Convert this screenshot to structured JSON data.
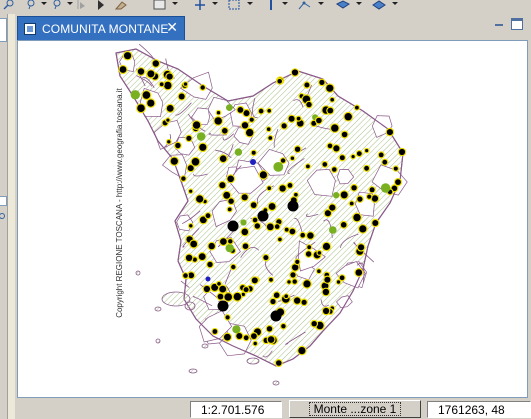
{
  "toolbar": {
    "buttons": [
      {
        "icon": "zoom-in-icon"
      },
      {
        "icon": "zoom-out-icon"
      },
      {
        "icon": "zoom-box-icon"
      },
      {
        "icon": "select-pointer-icon"
      },
      {
        "icon": "eraser-icon"
      },
      {
        "icon": "pan-icon"
      },
      {
        "icon": "select-rect-icon"
      },
      {
        "icon": "info-icon"
      },
      {
        "icon": "measure-icon"
      },
      {
        "icon": "layer-icon"
      },
      {
        "icon": "edit-icon"
      }
    ]
  },
  "tab": {
    "label": "COMUNITA MONTANE",
    "icon": "map-document-icon",
    "close_symbol": "✕"
  },
  "map": {
    "copyright": "Copyright REGIONE TOSCANA - http://www.geografia.toscana.it",
    "colors": {
      "background": "#ffffff",
      "boundary": "#8a5a8a",
      "hatch": "#a8c088",
      "point_black": "#000000",
      "point_yellow": "#f0e000",
      "point_green": "#78b020",
      "point_blue": "#2020c0"
    }
  },
  "status": {
    "scale": "1:2.701.576",
    "layer_button": "Monte ...zone 1",
    "coordinates": "1761263, 48"
  }
}
